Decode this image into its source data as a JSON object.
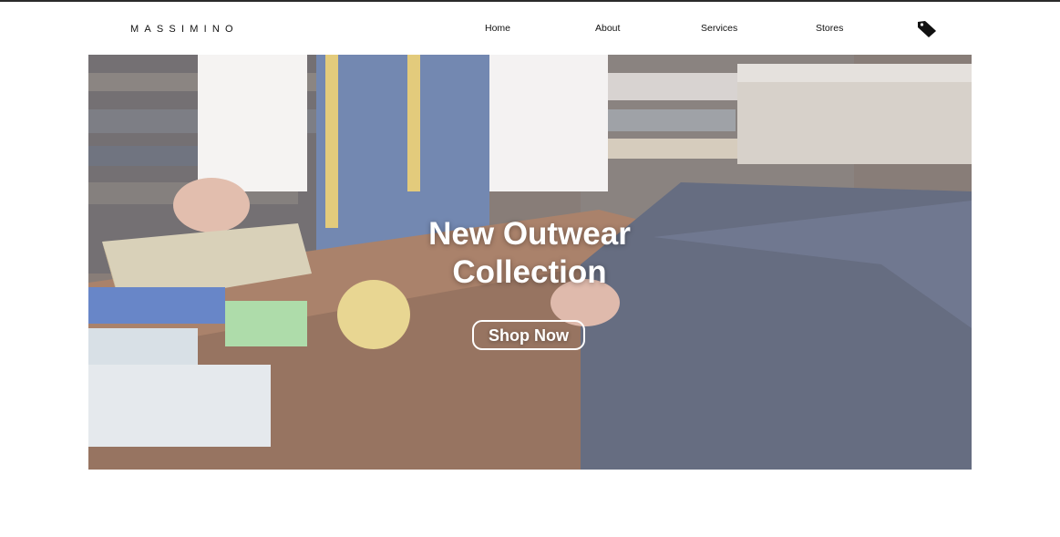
{
  "brand": {
    "logo_text": "MASSIMINO"
  },
  "nav": {
    "links": [
      {
        "label": "Home"
      },
      {
        "label": "About"
      },
      {
        "label": "Services"
      },
      {
        "label": "Stores"
      }
    ],
    "tag_icon": "price-tag-icon"
  },
  "hero": {
    "headline_line1": "New Outwear",
    "headline_line2": "Collection",
    "cta_label": "Shop Now",
    "image_subject": "tailor-workshop-photo"
  },
  "colors": {
    "background": "#ffffff",
    "text": "#111111",
    "hero_text": "#ffffff",
    "top_border": "#2b2b2b"
  }
}
